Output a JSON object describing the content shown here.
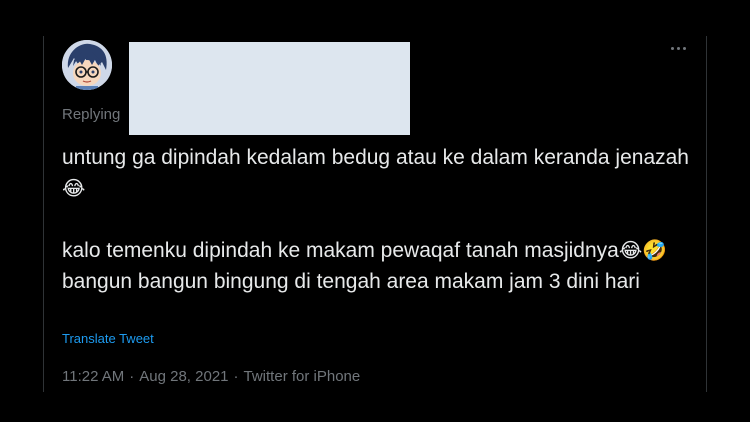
{
  "reply": {
    "replying_label": "Replying"
  },
  "tweet": {
    "paragraph_1": "untung ga dipindah kedalam bedug atau ke dalam keranda jenazah",
    "paragraph_1_emoji": "😂",
    "paragraph_2_part_1": "kalo temenku dipindah ke makam pewaqaf tanah masjidnya",
    "paragraph_2_emoji_1": "😂",
    "paragraph_2_emoji_2": "🤣",
    "paragraph_2_part_2": " bangun bangun bingung di tengah area makam jam 3 dini hari",
    "translate_label": "Translate Tweet"
  },
  "meta": {
    "time": "11:22 AM",
    "separator": "·",
    "date": "Aug 28, 2021",
    "source": "Twitter for iPhone"
  },
  "icons": {
    "more": "more-horizontal-icon"
  },
  "colors": {
    "background": "#000000",
    "text": "#e7e9ea",
    "secondary": "#71767b",
    "link": "#1d9bf0",
    "redaction": "#dde6ef"
  }
}
